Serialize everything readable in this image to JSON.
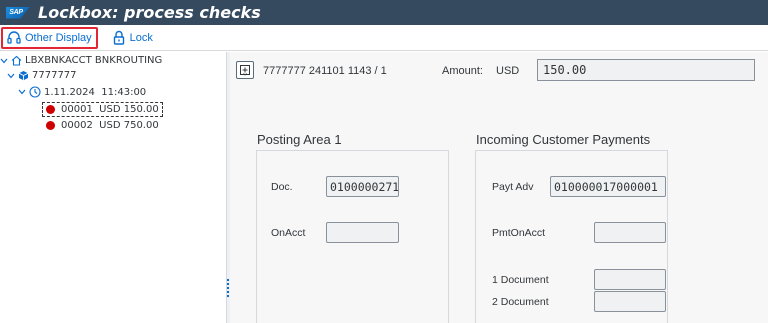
{
  "window": {
    "logo_text": "SAP",
    "title": "Lockbox: process checks"
  },
  "toolbar": {
    "other_display_label": "Other Display",
    "lock_label": "Lock",
    "accent_color": "#0a6ed1",
    "highlight_color": "#e32636"
  },
  "tree": {
    "root_label": "LBXBNKACCT BNKROUTING",
    "account_label": "7777777",
    "date_label": "1.11.2024  11:43:00",
    "items": [
      {
        "label": "00001  USD 150.00",
        "status": "red",
        "selected": true
      },
      {
        "label": "00002  USD 750.00",
        "status": "red",
        "selected": false
      }
    ]
  },
  "header": {
    "check_id": "7777777 241101 1143 / 1",
    "amount_label": "Amount:",
    "currency": "USD",
    "amount_value": "150.00"
  },
  "posting_area": {
    "title": "Posting Area 1",
    "doc_label": "Doc.",
    "doc_value": "0100000271",
    "onacct_label": "OnAcct",
    "onacct_value": ""
  },
  "incoming": {
    "title": "Incoming Customer Payments",
    "payt_adv_label": "Payt Adv",
    "payt_adv_value": "010000017000001",
    "pmt_on_acct_label": "PmtOnAcct",
    "pmt_on_acct_value": "",
    "doc1_label": "1 Document",
    "doc1_value": "",
    "doc2_label": "2 Document",
    "doc2_value": ""
  }
}
